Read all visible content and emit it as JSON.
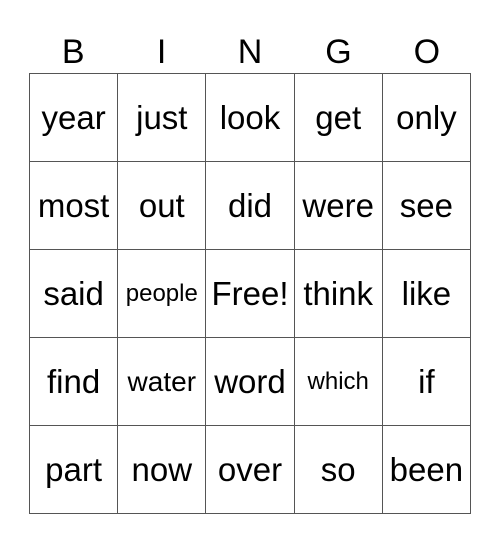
{
  "header": [
    "B",
    "I",
    "N",
    "G",
    "O"
  ],
  "grid": [
    [
      "year",
      "just",
      "look",
      "get",
      "only"
    ],
    [
      "most",
      "out",
      "did",
      "were",
      "see"
    ],
    [
      "said",
      "people",
      "Free!",
      "think",
      "like"
    ],
    [
      "find",
      "water",
      "word",
      "which",
      "if"
    ],
    [
      "part",
      "now",
      "over",
      "so",
      "been"
    ]
  ]
}
